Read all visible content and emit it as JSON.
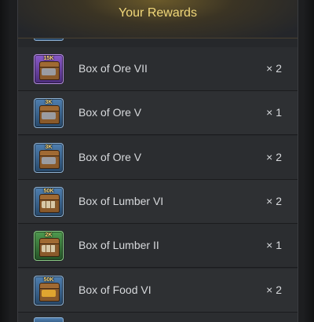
{
  "header": {
    "title": "Your Rewards"
  },
  "rewards": [
    {
      "name": "Box of Ore VII",
      "count": "× 2",
      "tag": "15K",
      "rarity": "purple",
      "kind": "ore"
    },
    {
      "name": "Box of Ore V",
      "count": "× 1",
      "tag": "3K",
      "rarity": "blue",
      "kind": "ore"
    },
    {
      "name": "Box of Ore V",
      "count": "× 2",
      "tag": "3K",
      "rarity": "blue",
      "kind": "ore"
    },
    {
      "name": "Box of Lumber VI",
      "count": "× 2",
      "tag": "50K",
      "rarity": "blue",
      "kind": "lumber"
    },
    {
      "name": "Box of Lumber II",
      "count": "× 1",
      "tag": "2K",
      "rarity": "green",
      "kind": "lumber"
    },
    {
      "name": "Box of Food VI",
      "count": "× 2",
      "tag": "50K",
      "rarity": "blue",
      "kind": "food"
    }
  ],
  "colors": {
    "title": "#f0d77a",
    "text": "#d7d9dc",
    "panel": "#26282b"
  }
}
